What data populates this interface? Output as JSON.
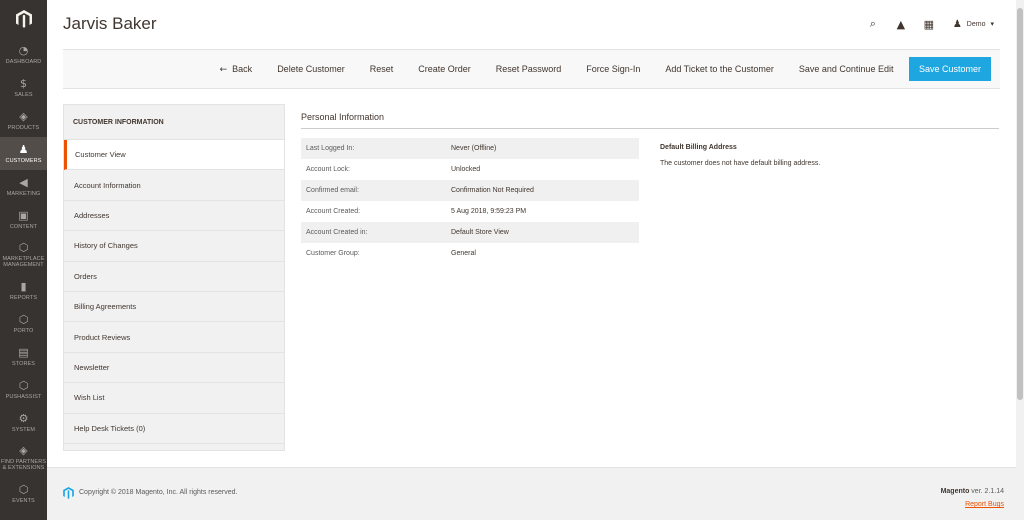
{
  "nav": {
    "items": [
      {
        "label": "DASHBOARD",
        "icon": "dashboard-icon"
      },
      {
        "label": "SALES",
        "icon": "dollar-icon"
      },
      {
        "label": "PRODUCTS",
        "icon": "cube-icon"
      },
      {
        "label": "CUSTOMERS",
        "icon": "person-icon"
      },
      {
        "label": "MARKETING",
        "icon": "megaphone-icon"
      },
      {
        "label": "CONTENT",
        "icon": "layout-icon"
      },
      {
        "label": "MARKETPLACE MANAGEMENT",
        "icon": "hexagon-icon"
      },
      {
        "label": "REPORTS",
        "icon": "bar-chart-icon"
      },
      {
        "label": "PORTO",
        "icon": "hexagon-icon"
      },
      {
        "label": "STORES",
        "icon": "store-icon"
      },
      {
        "label": "PUSHASSIST",
        "icon": "hexagon-icon"
      },
      {
        "label": "SYSTEM",
        "icon": "gear-icon"
      },
      {
        "label": "FIND PARTNERS & EXTENSIONS",
        "icon": "puzzle-icon"
      },
      {
        "label": "EVENTS",
        "icon": "hexagon-icon"
      }
    ]
  },
  "header": {
    "title": "Jarvis Baker",
    "user": "Demo"
  },
  "actions": {
    "back": "Back",
    "delete": "Delete Customer",
    "reset": "Reset",
    "create_order": "Create Order",
    "reset_password": "Reset Password",
    "force_signin": "Force Sign-In",
    "add_ticket": "Add Ticket to the Customer",
    "save_continue": "Save and Continue Edit",
    "save": "Save Customer"
  },
  "tabs": {
    "title": "CUSTOMER INFORMATION",
    "items": [
      "Customer View",
      "Account Information",
      "Addresses",
      "History of Changes",
      "Orders",
      "Billing Agreements",
      "Product Reviews",
      "Newsletter",
      "Wish List",
      "Help Desk Tickets (0)"
    ]
  },
  "personal": {
    "title": "Personal Information",
    "rows": [
      {
        "label": "Last Logged In:",
        "value": "Never (Offline)"
      },
      {
        "label": "Account Lock:",
        "value": "Unlocked"
      },
      {
        "label": "Confirmed email:",
        "value": "Confirmation Not Required"
      },
      {
        "label": "Account Created:",
        "value": "5 Aug 2018, 9:59:23 PM"
      },
      {
        "label": "Account Created in:",
        "value": "Default Store View"
      },
      {
        "label": "Customer Group:",
        "value": "General"
      }
    ]
  },
  "billing": {
    "title": "Default Billing Address",
    "text": "The customer does not have default billing address."
  },
  "footer": {
    "copyright": "Copyright © 2018 Magento, Inc. All rights reserved.",
    "brand": "Magento",
    "version": "ver. 2.1.14",
    "report": "Report Bugs"
  },
  "colors": {
    "nav_bg": "#373330",
    "accent": "#eb5202",
    "primary_button": "#1ea6e1"
  }
}
